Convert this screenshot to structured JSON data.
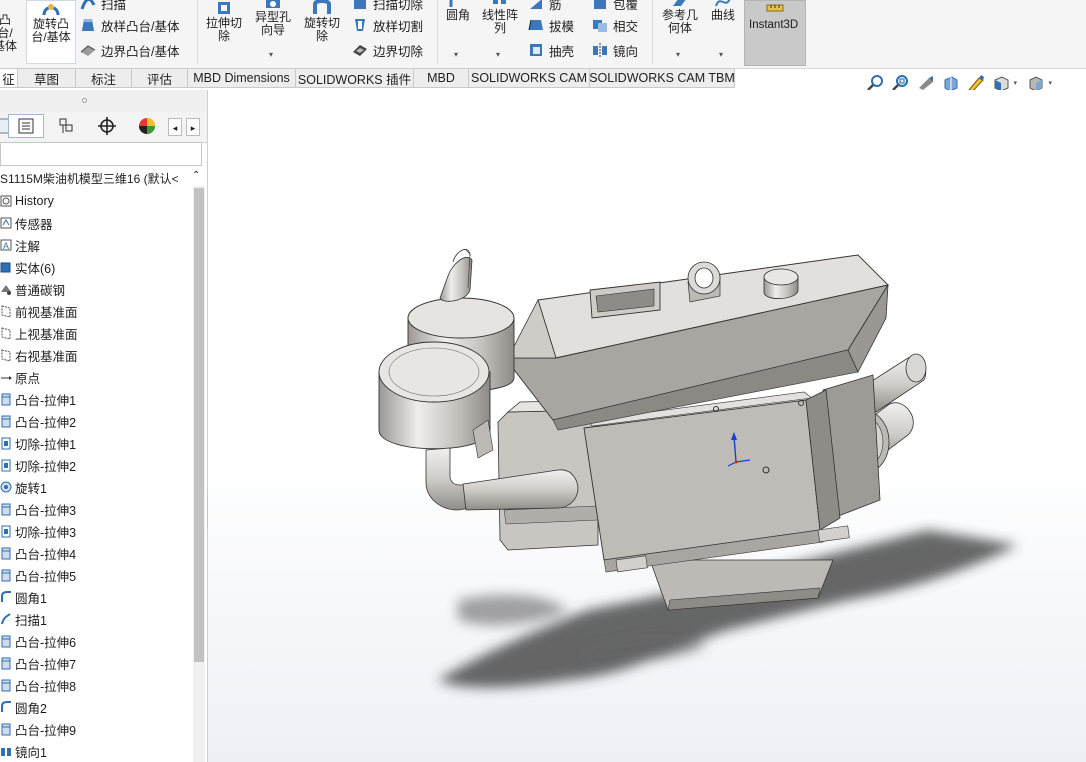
{
  "ribbon": {
    "boss_base_partial": "凸台/基体",
    "revolve_boss": "旋转凸台/基体",
    "sweep": "扫描",
    "loft_boss": "放样凸台/基体",
    "boundary_boss": "边界凸台/基体",
    "extruded_cut": "拉伸切除",
    "hole_wizard": "异型孔向导",
    "revolve_cut": "旋转切除",
    "swept_cut": "扫描切除",
    "lofted_cut": "放样切割",
    "boundary_cut": "边界切除",
    "fillet": "圆角",
    "linear_pattern": "线性阵列",
    "rib": "筋",
    "draft": "拔模",
    "shell": "抽壳",
    "wrap": "包覆",
    "intersect": "相交",
    "mirror": "镜向",
    "ref_geometry": "参考几何体",
    "curves": "曲线",
    "instant3d": "Instant3D"
  },
  "tabs": [
    "征",
    "草图",
    "标注",
    "评估",
    "MBD Dimensions",
    "SOLIDWORKS 插件",
    "MBD",
    "SOLIDWORKS CAM",
    "SOLIDWORKS CAM TBM"
  ],
  "tree": {
    "root": "S1115M柴油机模型三维16  (默认<",
    "items": [
      {
        "label": "History",
        "icon": "history-icon"
      },
      {
        "label": "传感器",
        "icon": "sensor-icon"
      },
      {
        "label": "注解",
        "icon": "annotation-icon"
      },
      {
        "label": "实体(6)",
        "icon": "solid-bodies-icon"
      },
      {
        "label": "普通碳钢",
        "icon": "material-icon"
      },
      {
        "label": "前视基准面",
        "icon": "plane-icon"
      },
      {
        "label": "上视基准面",
        "icon": "plane-icon"
      },
      {
        "label": "右视基准面",
        "icon": "plane-icon"
      },
      {
        "label": "原点",
        "icon": "origin-icon"
      },
      {
        "label": "凸台-拉伸1",
        "icon": "extrude-icon"
      },
      {
        "label": "凸台-拉伸2",
        "icon": "extrude-icon"
      },
      {
        "label": "切除-拉伸1",
        "icon": "cut-extrude-icon"
      },
      {
        "label": "切除-拉伸2",
        "icon": "cut-extrude-icon"
      },
      {
        "label": "旋转1",
        "icon": "revolve-icon"
      },
      {
        "label": "凸台-拉伸3",
        "icon": "extrude-icon"
      },
      {
        "label": "切除-拉伸3",
        "icon": "cut-extrude-icon"
      },
      {
        "label": "凸台-拉伸4",
        "icon": "extrude-icon"
      },
      {
        "label": "凸台-拉伸5",
        "icon": "extrude-icon"
      },
      {
        "label": "圆角1",
        "icon": "fillet-icon"
      },
      {
        "label": "扫描1",
        "icon": "sweep-icon"
      },
      {
        "label": "凸台-拉伸6",
        "icon": "extrude-icon"
      },
      {
        "label": "凸台-拉伸7",
        "icon": "extrude-icon"
      },
      {
        "label": "凸台-拉伸8",
        "icon": "extrude-icon"
      },
      {
        "label": "圆角2",
        "icon": "fillet-icon"
      },
      {
        "label": "凸台-拉伸9",
        "icon": "extrude-icon"
      },
      {
        "label": "镜向1",
        "icon": "mirror-icon"
      }
    ]
  },
  "colors": {
    "ribbon_bg": "#f5f5f5",
    "instant3d_active": "#c9c9c9",
    "icon_blue": "#2f6fb3",
    "model_face_light": "#d9d7d4",
    "model_face_mid": "#bdbab6",
    "model_face_dark": "#8f8c88",
    "axis_blue": "#1240d8"
  }
}
